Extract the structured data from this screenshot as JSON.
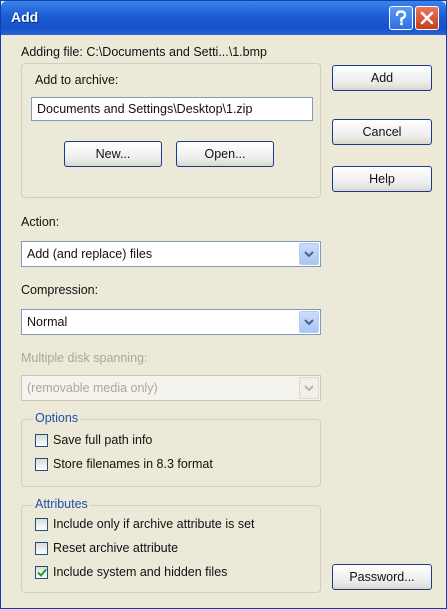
{
  "window": {
    "title": "Add"
  },
  "icons": {
    "help": "help-icon",
    "close": "close-icon",
    "dropdown": "chevron-down-icon",
    "check": "checkmark-icon"
  },
  "colors": {
    "titlebar": "#1b5bd6",
    "dialog_bg": "#ece9d8",
    "group_label": "#1f4fb0",
    "close": "#c73d1a"
  },
  "adding_file": "Adding file: C:\\Documents and Setti...\\1.bmp",
  "archive": {
    "label": "Add to archive:",
    "path": "Documents and Settings\\Desktop\\1.zip",
    "new_label": "New...",
    "open_label": "Open..."
  },
  "buttons": {
    "add": "Add",
    "cancel": "Cancel",
    "help": "Help",
    "password": "Password..."
  },
  "action": {
    "label": "Action:",
    "value": "Add (and replace) files"
  },
  "compression": {
    "label": "Compression:",
    "value": "Normal"
  },
  "spanning": {
    "label": "Multiple disk spanning:",
    "value": "(removable media only)"
  },
  "options": {
    "title": "Options",
    "items": [
      {
        "label": "Save full path info",
        "checked": false
      },
      {
        "label": "Store filenames in 8.3 format",
        "checked": false
      }
    ]
  },
  "attributes": {
    "title": "Attributes",
    "items": [
      {
        "label": "Include only if archive attribute is set",
        "checked": false
      },
      {
        "label": "Reset archive attribute",
        "checked": false
      },
      {
        "label": "Include system and hidden files",
        "checked": true
      }
    ]
  }
}
